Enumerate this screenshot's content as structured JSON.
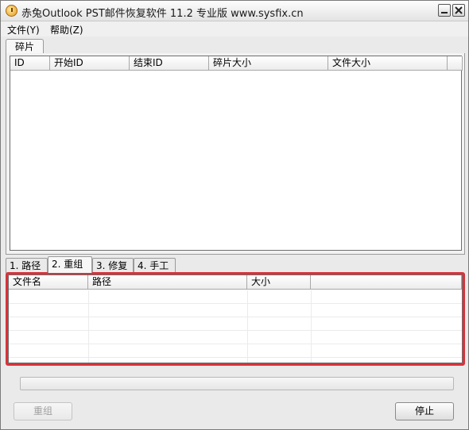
{
  "window": {
    "title": "赤兔Outlook PST邮件恢复软件 11.2 专业版 www.sysfix.cn",
    "minimize_icon": "minimize-icon",
    "close_icon": "close-icon"
  },
  "menu": [
    {
      "label": "文件(Y)"
    },
    {
      "label": "帮助(Z)"
    }
  ],
  "top_tab": {
    "label": "碎片"
  },
  "fragments_table": {
    "columns": [
      "ID",
      "开始ID",
      "结束ID",
      "碎片大小",
      "文件大小"
    ],
    "rows": []
  },
  "bottom_tabs": [
    {
      "label": "1. 路径",
      "active": false
    },
    {
      "label": "2. 重组",
      "active": true
    },
    {
      "label": "3. 修复",
      "active": false
    },
    {
      "label": "4. 手工",
      "active": false
    }
  ],
  "files_table": {
    "columns": [
      "文件名",
      "路径",
      "大小",
      ""
    ],
    "rows": [],
    "highlight_color": "#d9323a"
  },
  "progress": {
    "value": 0
  },
  "buttons": {
    "reassemble_label": "重组",
    "reassemble_enabled": false,
    "stop_label": "停止"
  }
}
